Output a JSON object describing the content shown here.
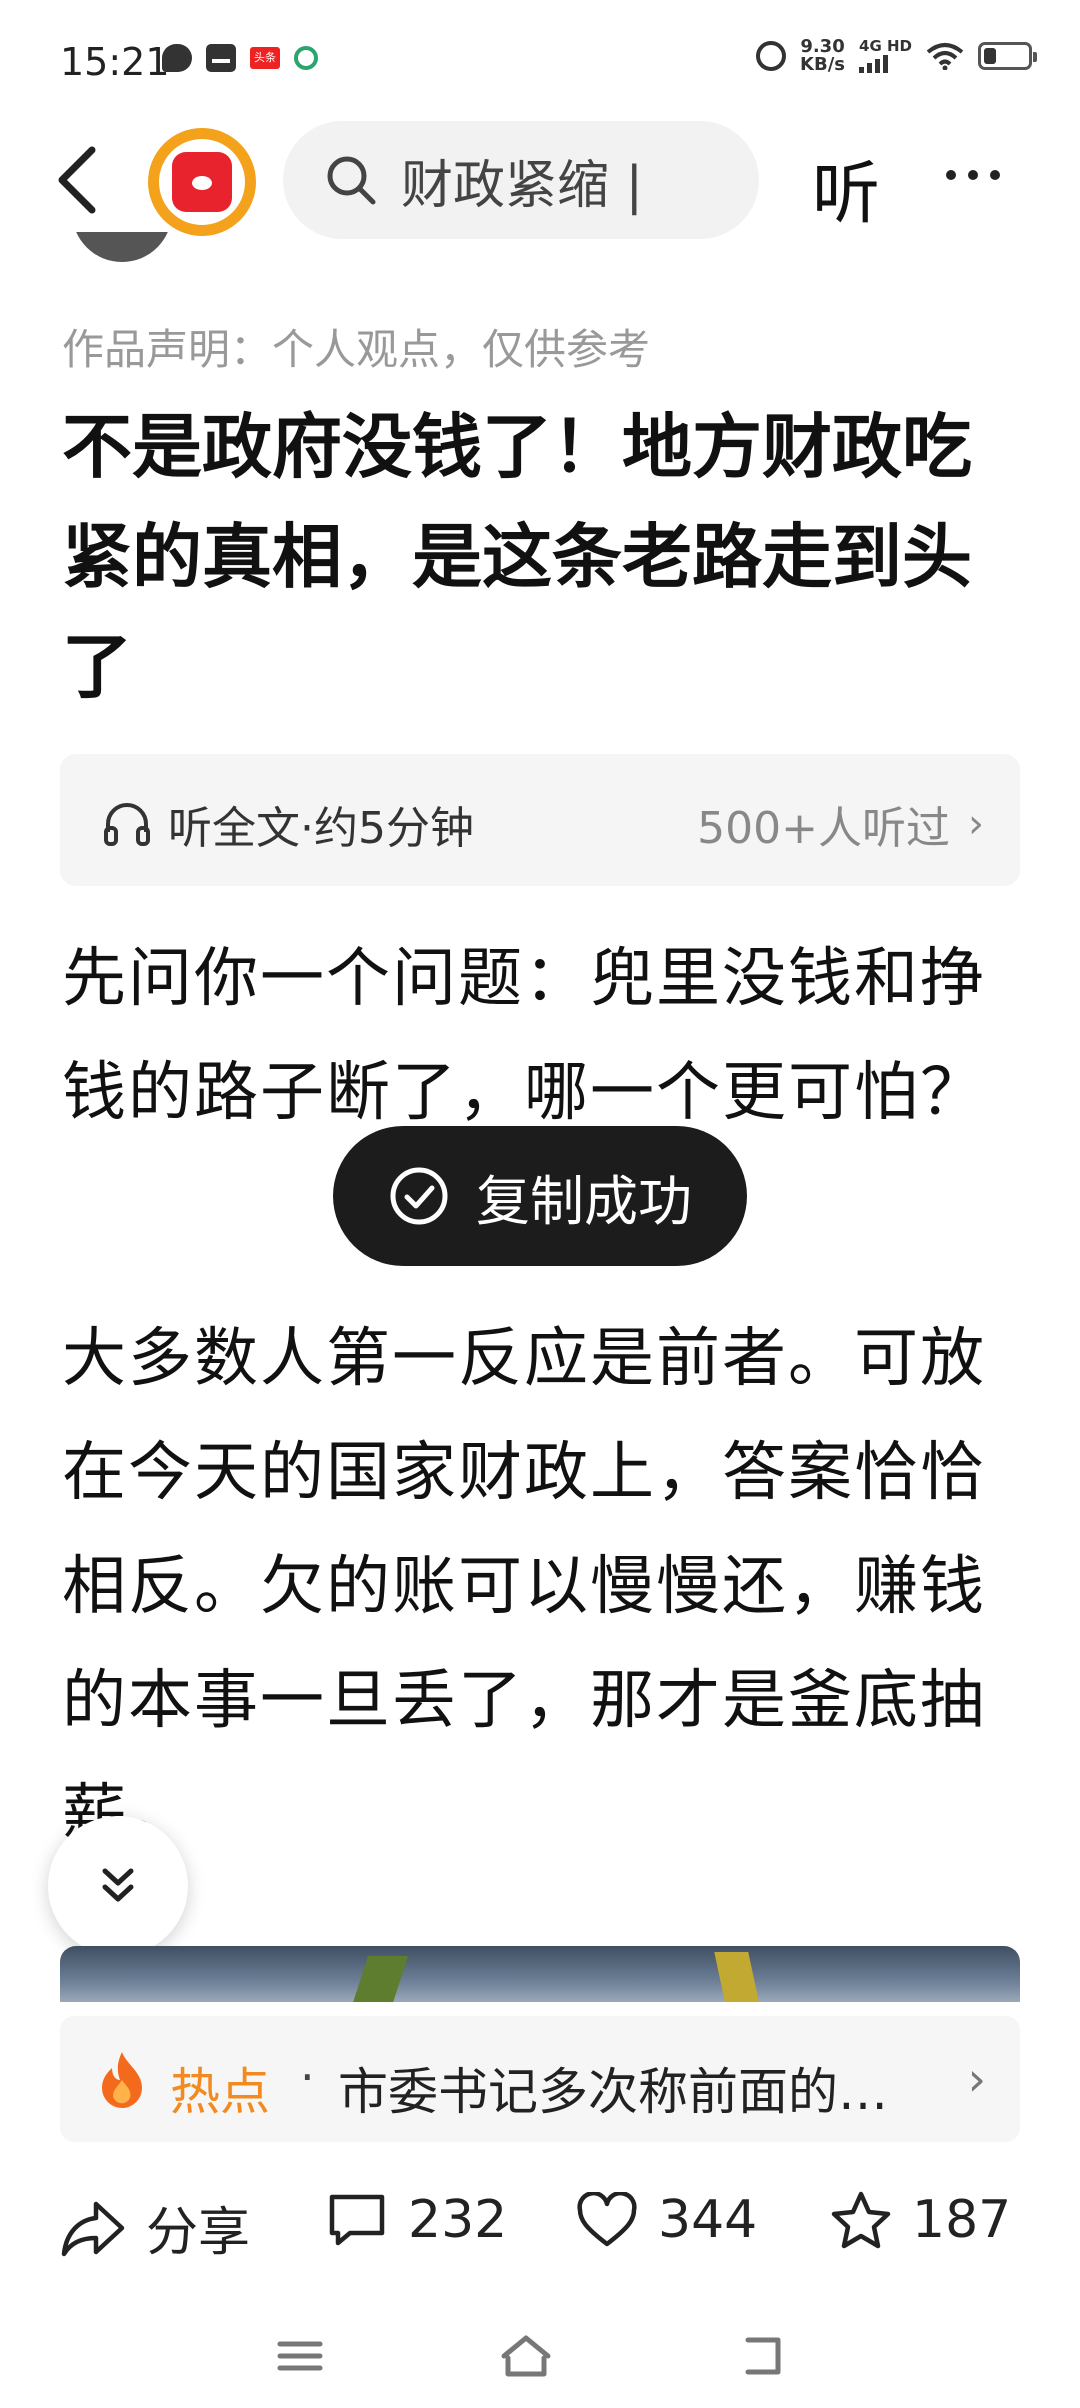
{
  "status_bar": {
    "time": "15:21",
    "badge_text": "头条",
    "net_speed_value": "9.30",
    "net_speed_unit": "KB/s",
    "network_label": "4G HD"
  },
  "nav": {
    "search_query": "财政紧缩 |",
    "listen_label": "听"
  },
  "article": {
    "declaration": "作品声明：个人观点，仅供参考",
    "title": "不是政府没钱了！地方财政吃紧的真相，是这条老路走到头了",
    "audio": {
      "left_text": "听全文·约5分钟",
      "right_text": "500+人听过"
    },
    "paragraphs": [
      "先问你一个问题：兜里没钱和挣钱的路子断了，哪一个更可怕？",
      "大多数人第一反应是前者。可放在今天的国家财政上，答案恰恰相反。欠的账可以慢慢还，赚钱的本事一旦丢了，那才是釜底抽薪。"
    ]
  },
  "toast": {
    "text": "复制成功"
  },
  "hot": {
    "label": "热点",
    "separator": "·",
    "text": "市委书记多次称前面的…"
  },
  "actions": {
    "share_label": "分享",
    "comments_count": "232",
    "likes_count": "344",
    "favorites_count": "187"
  },
  "colors": {
    "accent_orange": "#f28a1f",
    "brand_red": "#e8232d",
    "toast_bg": "#1c1c1c"
  }
}
